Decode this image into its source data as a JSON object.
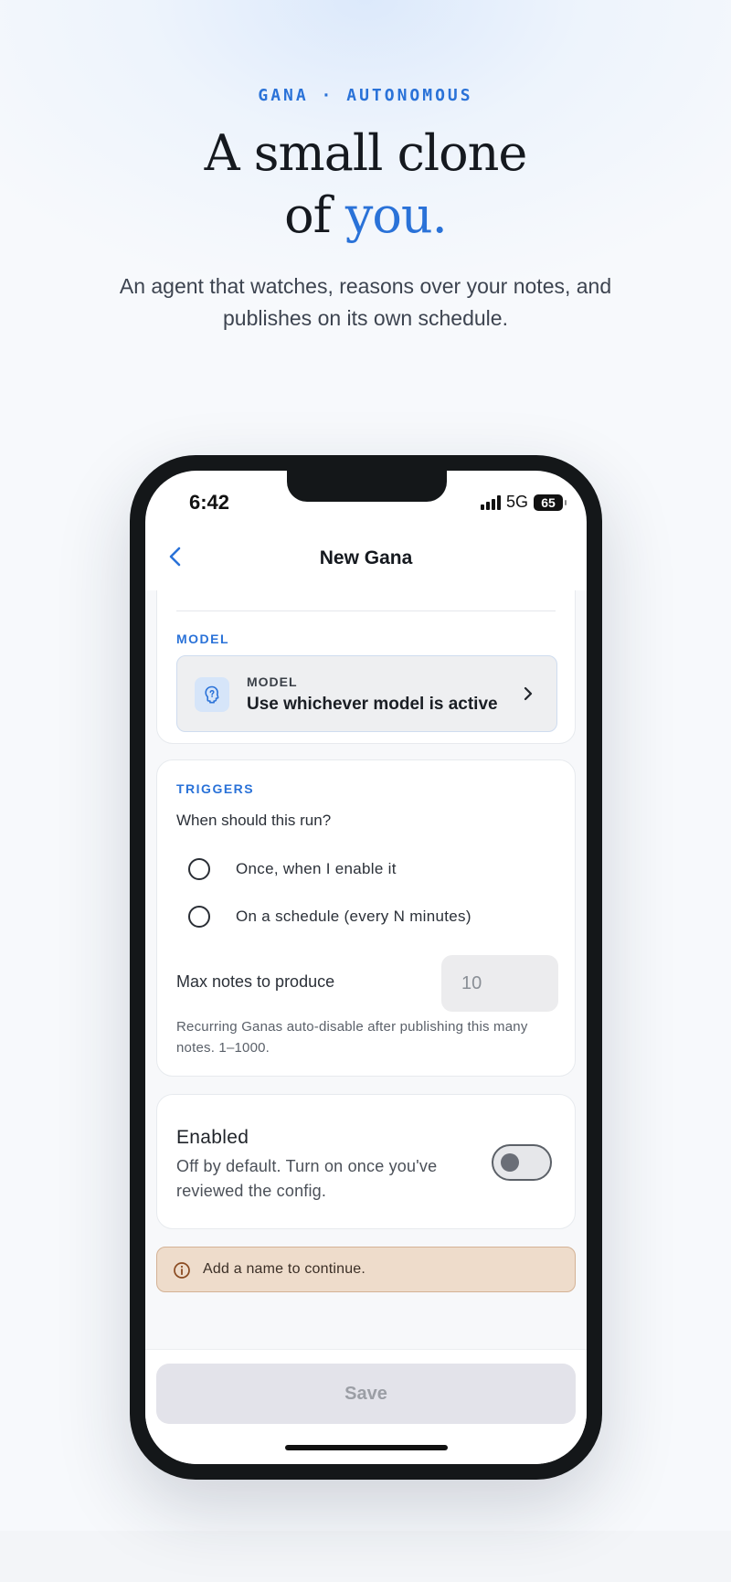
{
  "hero": {
    "eyebrow": "GANA · AUTONOMOUS",
    "headline_line1": "A small clone",
    "headline_line2_prefix": "of ",
    "headline_accent": "you.",
    "subhead": "An agent that watches, reasons over your notes, and publishes on its own schedule."
  },
  "status_bar": {
    "time": "6:42",
    "network": "5G",
    "battery": "65"
  },
  "nav": {
    "title": "New Gana"
  },
  "model_section": {
    "label": "MODEL",
    "selector_kicker": "MODEL",
    "selector_value": "Use whichever model is active"
  },
  "triggers": {
    "label": "TRIGGERS",
    "question": "When should this run?",
    "options": [
      "Once, when I enable it",
      "On a schedule (every N minutes)"
    ],
    "max_label": "Max notes to produce",
    "max_placeholder": "10",
    "help": "Recurring Ganas auto-disable after publishing this many notes. 1–1000."
  },
  "enabled": {
    "title": "Enabled",
    "description": "Off by default. Turn on once you've reviewed the config.",
    "on": false
  },
  "warning": {
    "text": "Add a name to continue."
  },
  "footer": {
    "save_label": "Save"
  },
  "colors": {
    "accent": "#2a72d8",
    "warning_bg": "#eedccb",
    "disabled_button": "#e3e3ea"
  }
}
